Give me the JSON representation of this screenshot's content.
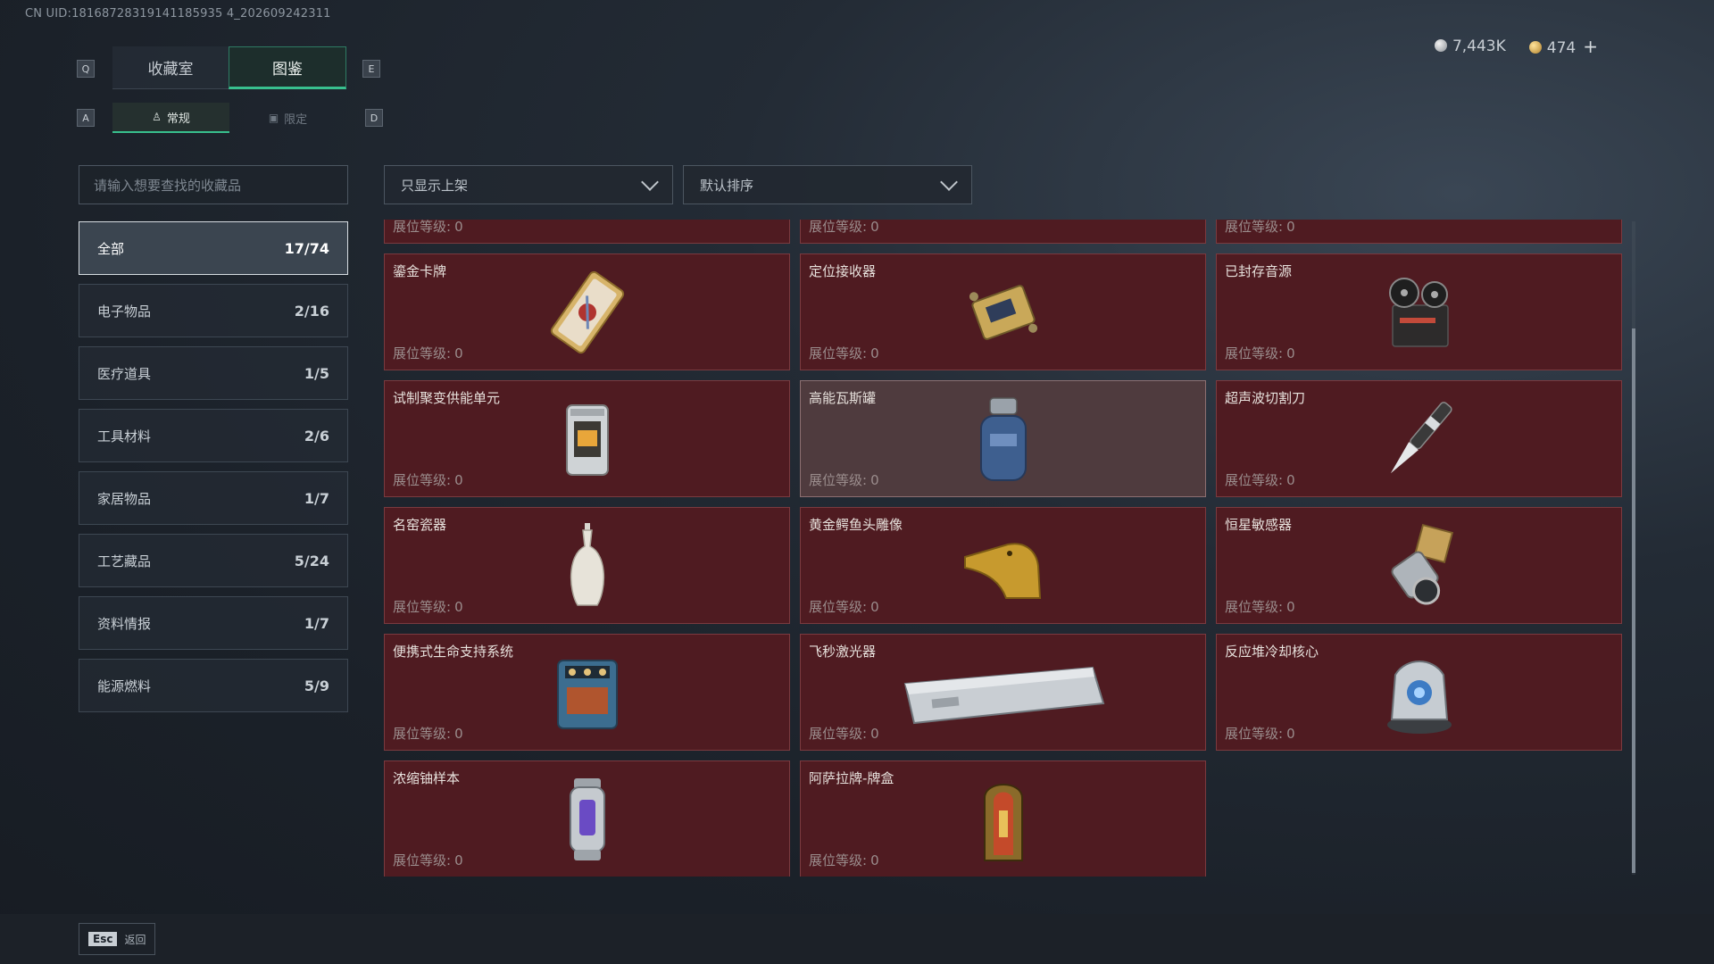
{
  "uid": "CN UID:18168728319141185935 4_202609242311",
  "key_hints": {
    "q": "Q",
    "e": "E",
    "a": "A",
    "d": "D"
  },
  "tabs": [
    {
      "label": "收藏室",
      "active": false
    },
    {
      "label": "图鉴",
      "active": true
    }
  ],
  "subtabs": [
    {
      "label": "常规",
      "icon": "figure-icon",
      "active": true
    },
    {
      "label": "限定",
      "icon": "image-icon",
      "active": false
    }
  ],
  "currency": {
    "silver": "7,443K",
    "gold": "474",
    "plus": "+"
  },
  "search": {
    "placeholder": "请输入想要查找的收藏品"
  },
  "categories": [
    {
      "label": "全部",
      "count": "17/74",
      "active": true
    },
    {
      "label": "电子物品",
      "count": "2/16"
    },
    {
      "label": "医疗道具",
      "count": "1/5"
    },
    {
      "label": "工具材料",
      "count": "2/6"
    },
    {
      "label": "家居物品",
      "count": "1/7"
    },
    {
      "label": "工艺藏品",
      "count": "5/24"
    },
    {
      "label": "资料情报",
      "count": "1/7"
    },
    {
      "label": "能源燃料",
      "count": "5/9"
    }
  ],
  "filters": {
    "shelf": "只显示上架",
    "sort": "默认排序"
  },
  "level_label": "展位等级:",
  "items": [
    {
      "name": "",
      "level": "0",
      "icon": "partial-item-icon"
    },
    {
      "name": "",
      "level": "0",
      "icon": "partial-item-icon"
    },
    {
      "name": "",
      "level": "0",
      "icon": "partial-item-icon"
    },
    {
      "name": "鎏金卡牌",
      "level": "0",
      "icon": "gilded-card-icon"
    },
    {
      "name": "定位接收器",
      "level": "0",
      "icon": "locator-receiver-icon"
    },
    {
      "name": "已封存音源",
      "level": "0",
      "icon": "reel-recorder-icon"
    },
    {
      "name": "试制聚变供能单元",
      "level": "0",
      "icon": "fusion-unit-icon"
    },
    {
      "name": "高能瓦斯罐",
      "level": "0",
      "icon": "gas-canister-icon",
      "highlight": true
    },
    {
      "name": "超声波切割刀",
      "level": "0",
      "icon": "ultrasonic-knife-icon"
    },
    {
      "name": "名窑瓷器",
      "level": "0",
      "icon": "porcelain-vase-icon"
    },
    {
      "name": "黄金鳄鱼头雕像",
      "level": "0",
      "icon": "gold-crocodile-icon"
    },
    {
      "name": "恒星敏感器",
      "level": "0",
      "icon": "star-sensor-icon"
    },
    {
      "name": "便携式生命支持系统",
      "level": "0",
      "icon": "life-support-icon"
    },
    {
      "name": "飞秒激光器",
      "level": "0",
      "icon": "femtosecond-laser-icon"
    },
    {
      "name": "反应堆冷却核心",
      "level": "0",
      "icon": "reactor-core-icon"
    },
    {
      "name": "浓缩铀样本",
      "level": "0",
      "icon": "uranium-sample-icon"
    },
    {
      "name": "阿萨拉牌-牌盒",
      "level": "0",
      "icon": "card-box-icon"
    }
  ],
  "footer": {
    "esc_key": "Esc",
    "esc_label": "返回"
  }
}
